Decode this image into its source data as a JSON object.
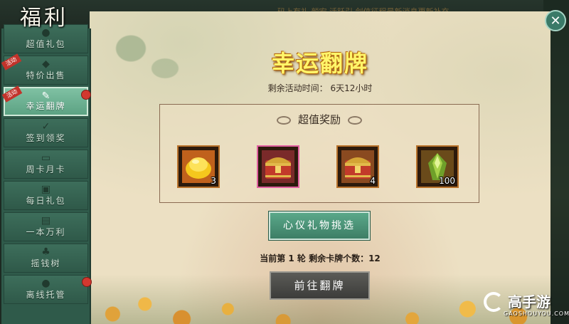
{
  "window": {
    "title": "福利",
    "ticker": "码上有礼  颜宏    活跃引  剑侠征程最新消息更新补充"
  },
  "sidebar": {
    "items": [
      {
        "label": "超值礼包",
        "icon": "bag-icon",
        "tag": "",
        "dot": false
      },
      {
        "label": "特价出售",
        "icon": "coin-sack-icon",
        "tag": "活动",
        "dot": false
      },
      {
        "label": "幸运翻牌",
        "icon": "card-flip-icon",
        "tag": "活动",
        "dot": true
      },
      {
        "label": "签到领奖",
        "icon": "sign-in-icon",
        "tag": "",
        "dot": false
      },
      {
        "label": "周卡月卡",
        "icon": "card-icon",
        "tag": "",
        "dot": false
      },
      {
        "label": "每日礼包",
        "icon": "gift-icon",
        "tag": "",
        "dot": false
      },
      {
        "label": "一本万利",
        "icon": "book-icon",
        "tag": "",
        "dot": false
      },
      {
        "label": "摇钱树",
        "icon": "money-tree-icon",
        "tag": "",
        "dot": false
      },
      {
        "label": "离线托管",
        "icon": "bag-icon",
        "tag": "",
        "dot": true
      }
    ]
  },
  "event": {
    "title": "幸运翻牌",
    "remaining": "剩余活动时间： 6天12小时"
  },
  "rewards": {
    "heading": "超值奖励",
    "items": [
      {
        "name": "gold-ingot-icon",
        "qty": "3",
        "frame": "#b8722b"
      },
      {
        "name": "treasure-chest-icon",
        "qty": "",
        "frame": "#e060a0"
      },
      {
        "name": "treasure-chest-icon",
        "qty": "4",
        "frame": "#b8722b"
      },
      {
        "name": "green-gem-icon",
        "qty": "100",
        "frame": "#b8722b"
      }
    ]
  },
  "buttons": {
    "gift_select": "心仪礼物挑选",
    "go_flip": "前往翻牌"
  },
  "round_info": "当前第 1 轮   剩余卡牌个数：12",
  "watermark": {
    "name": "高手游",
    "url": "GAOSHOUYOU.COM"
  }
}
